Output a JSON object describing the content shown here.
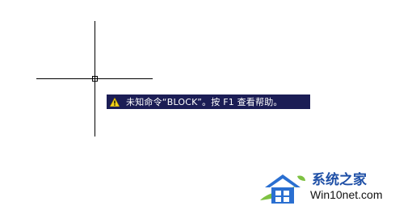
{
  "cad_view": {
    "tooltip": {
      "icon": "warning-icon",
      "text": "未知命令“BLOCK”。按 F1 查看帮助。",
      "background": "#1b1d55",
      "text_color": "#ffffff"
    }
  },
  "watermark": {
    "title": "系统之家",
    "subtitle": "Win10net.com",
    "colors": {
      "roof": "#2a6fd1",
      "accent": "#7ec242",
      "text": "#1e4fa6"
    }
  }
}
